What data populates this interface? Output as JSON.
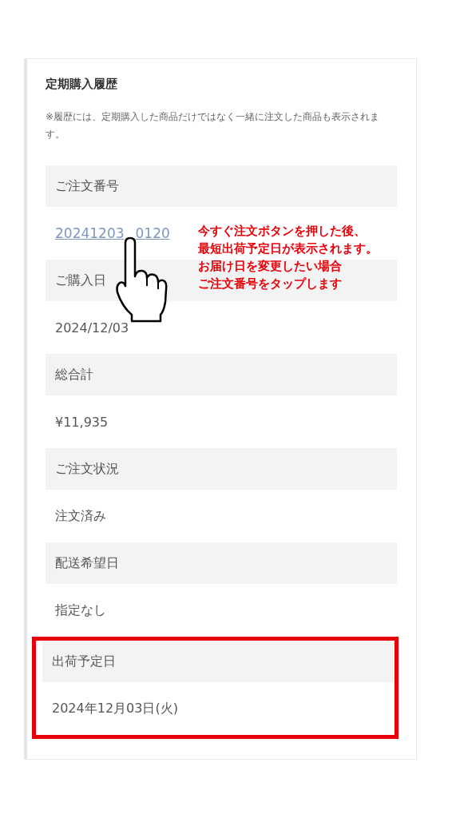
{
  "title": "定期購入履歴",
  "note": "※履歴には、定期購入した商品だけではなく一緒に注文した商品も表示されます。",
  "fields": [
    {
      "label": "ご注文番号",
      "kind": "link",
      "value_start": "20241203",
      "value_end": "0120",
      "highlighted": false
    },
    {
      "label": "ご購入日",
      "kind": "text",
      "value": "2024/12/03",
      "highlighted": false
    },
    {
      "label": "総合計",
      "kind": "text",
      "value": "¥11,935",
      "highlighted": false
    },
    {
      "label": "ご注文状況",
      "kind": "text",
      "value": "注文済み",
      "highlighted": false
    },
    {
      "label": "配送希望日",
      "kind": "text",
      "value": "指定なし",
      "highlighted": false
    },
    {
      "label": "出荷予定日",
      "kind": "text",
      "value": "2024年12月03日(火)",
      "highlighted": true
    }
  ],
  "annotation": [
    "今すぐ注文ボタンを押した後、",
    "最短出荷予定日が表示されます。",
    "お届け日を変更したい場合",
    "ご注文番号をタップします"
  ]
}
